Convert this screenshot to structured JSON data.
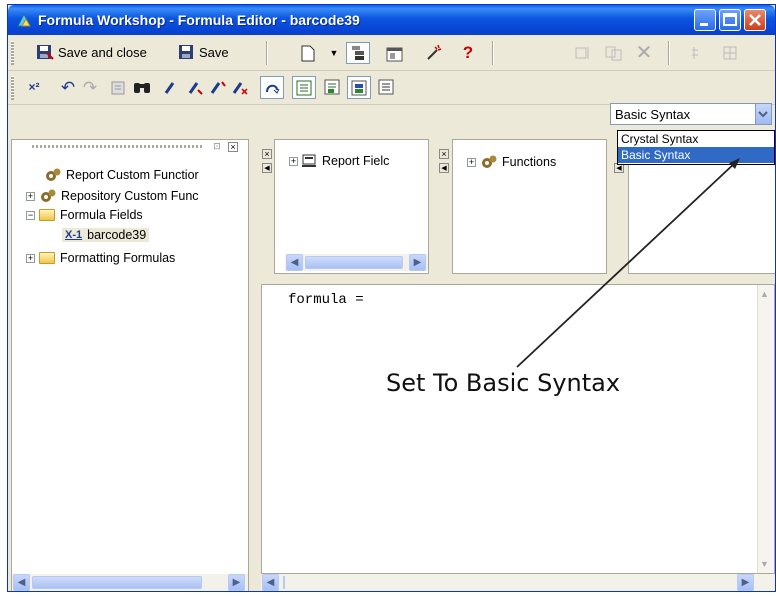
{
  "window": {
    "title": "Formula Workshop - Formula Editor - barcode39"
  },
  "toolbar1": {
    "save_and_close_label": "Save and close",
    "save_label": "Save",
    "help_glyph": "?"
  },
  "toolbar2": {
    "syntax_combo_value": "Basic Syntax",
    "syntax_options": [
      "Crystal Syntax",
      "Basic Syntax"
    ]
  },
  "tree": {
    "items": [
      {
        "label": "Report Custom Functior"
      },
      {
        "label": "Repository Custom Func"
      },
      {
        "label": "Formula Fields"
      },
      {
        "label": "barcode39"
      },
      {
        "label": "Formatting Formulas"
      }
    ]
  },
  "explorers": {
    "report_fields_label": "Report Fielc",
    "functions_label": "Functions"
  },
  "editor": {
    "code": "formula ="
  },
  "annotation": {
    "text": "Set To Basic Syntax"
  },
  "icons": {
    "app": "formula-workshop-icon",
    "minimize": "minimize-icon",
    "maximize": "maximize-icon",
    "close": "close-icon"
  },
  "colors": {
    "titlebar": "#0846d6",
    "selection": "#316ac5",
    "close_button": "#c9401f"
  }
}
